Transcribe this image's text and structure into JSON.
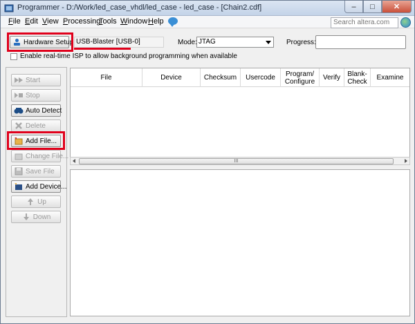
{
  "window": {
    "title": "Programmer - D:/Work/led_case_vhdl/led_case - led_case - [Chain2.cdf]",
    "controls": {
      "minimize": "–",
      "maximize": "□",
      "close": "✕"
    }
  },
  "menu": {
    "items": [
      {
        "key": "F",
        "rest": "ile"
      },
      {
        "key": "E",
        "rest": "dit"
      },
      {
        "key": "V",
        "rest": "iew"
      },
      {
        "key": "P",
        "rest": "rocessing"
      },
      {
        "key": "T",
        "rest": "ools"
      },
      {
        "key": "W",
        "rest": "indow"
      },
      {
        "key": "H",
        "rest": "elp"
      }
    ],
    "search_placeholder": "Search altera.com"
  },
  "toolbar": {
    "hardware_setup_label": "Hardware Setup...",
    "hardware_value": "USB-Blaster [USB-0]",
    "mode_label": "Mode:",
    "mode_value": "JTAG",
    "progress_label": "Progress:",
    "isp_label": "Enable real-time ISP to allow background programming when available"
  },
  "side_buttons": [
    {
      "label": "Start",
      "icon": "start-icon",
      "enabled": false
    },
    {
      "label": "Stop",
      "icon": "stop-icon",
      "enabled": false
    },
    {
      "label": "Auto Detect",
      "icon": "auto-detect-icon",
      "enabled": true
    },
    {
      "label": "Delete",
      "icon": "delete-icon",
      "enabled": false
    },
    {
      "label": "Add File...",
      "icon": "add-file-icon",
      "enabled": true
    },
    {
      "label": "Change File...",
      "icon": "change-file-icon",
      "enabled": false
    },
    {
      "label": "Save File",
      "icon": "save-file-icon",
      "enabled": false
    },
    {
      "label": "Add Device...",
      "icon": "add-device-icon",
      "enabled": true
    },
    {
      "label": "Up",
      "icon": "up-icon",
      "enabled": false
    },
    {
      "label": "Down",
      "icon": "down-icon",
      "enabled": false
    }
  ],
  "grid": {
    "columns": [
      "File",
      "Device",
      "Checksum",
      "Usercode",
      "Program/ Configure",
      "Verify",
      "Blank- Check",
      "Examine"
    ],
    "scroll_grip": "III"
  },
  "highlight_color": "#e0001b"
}
